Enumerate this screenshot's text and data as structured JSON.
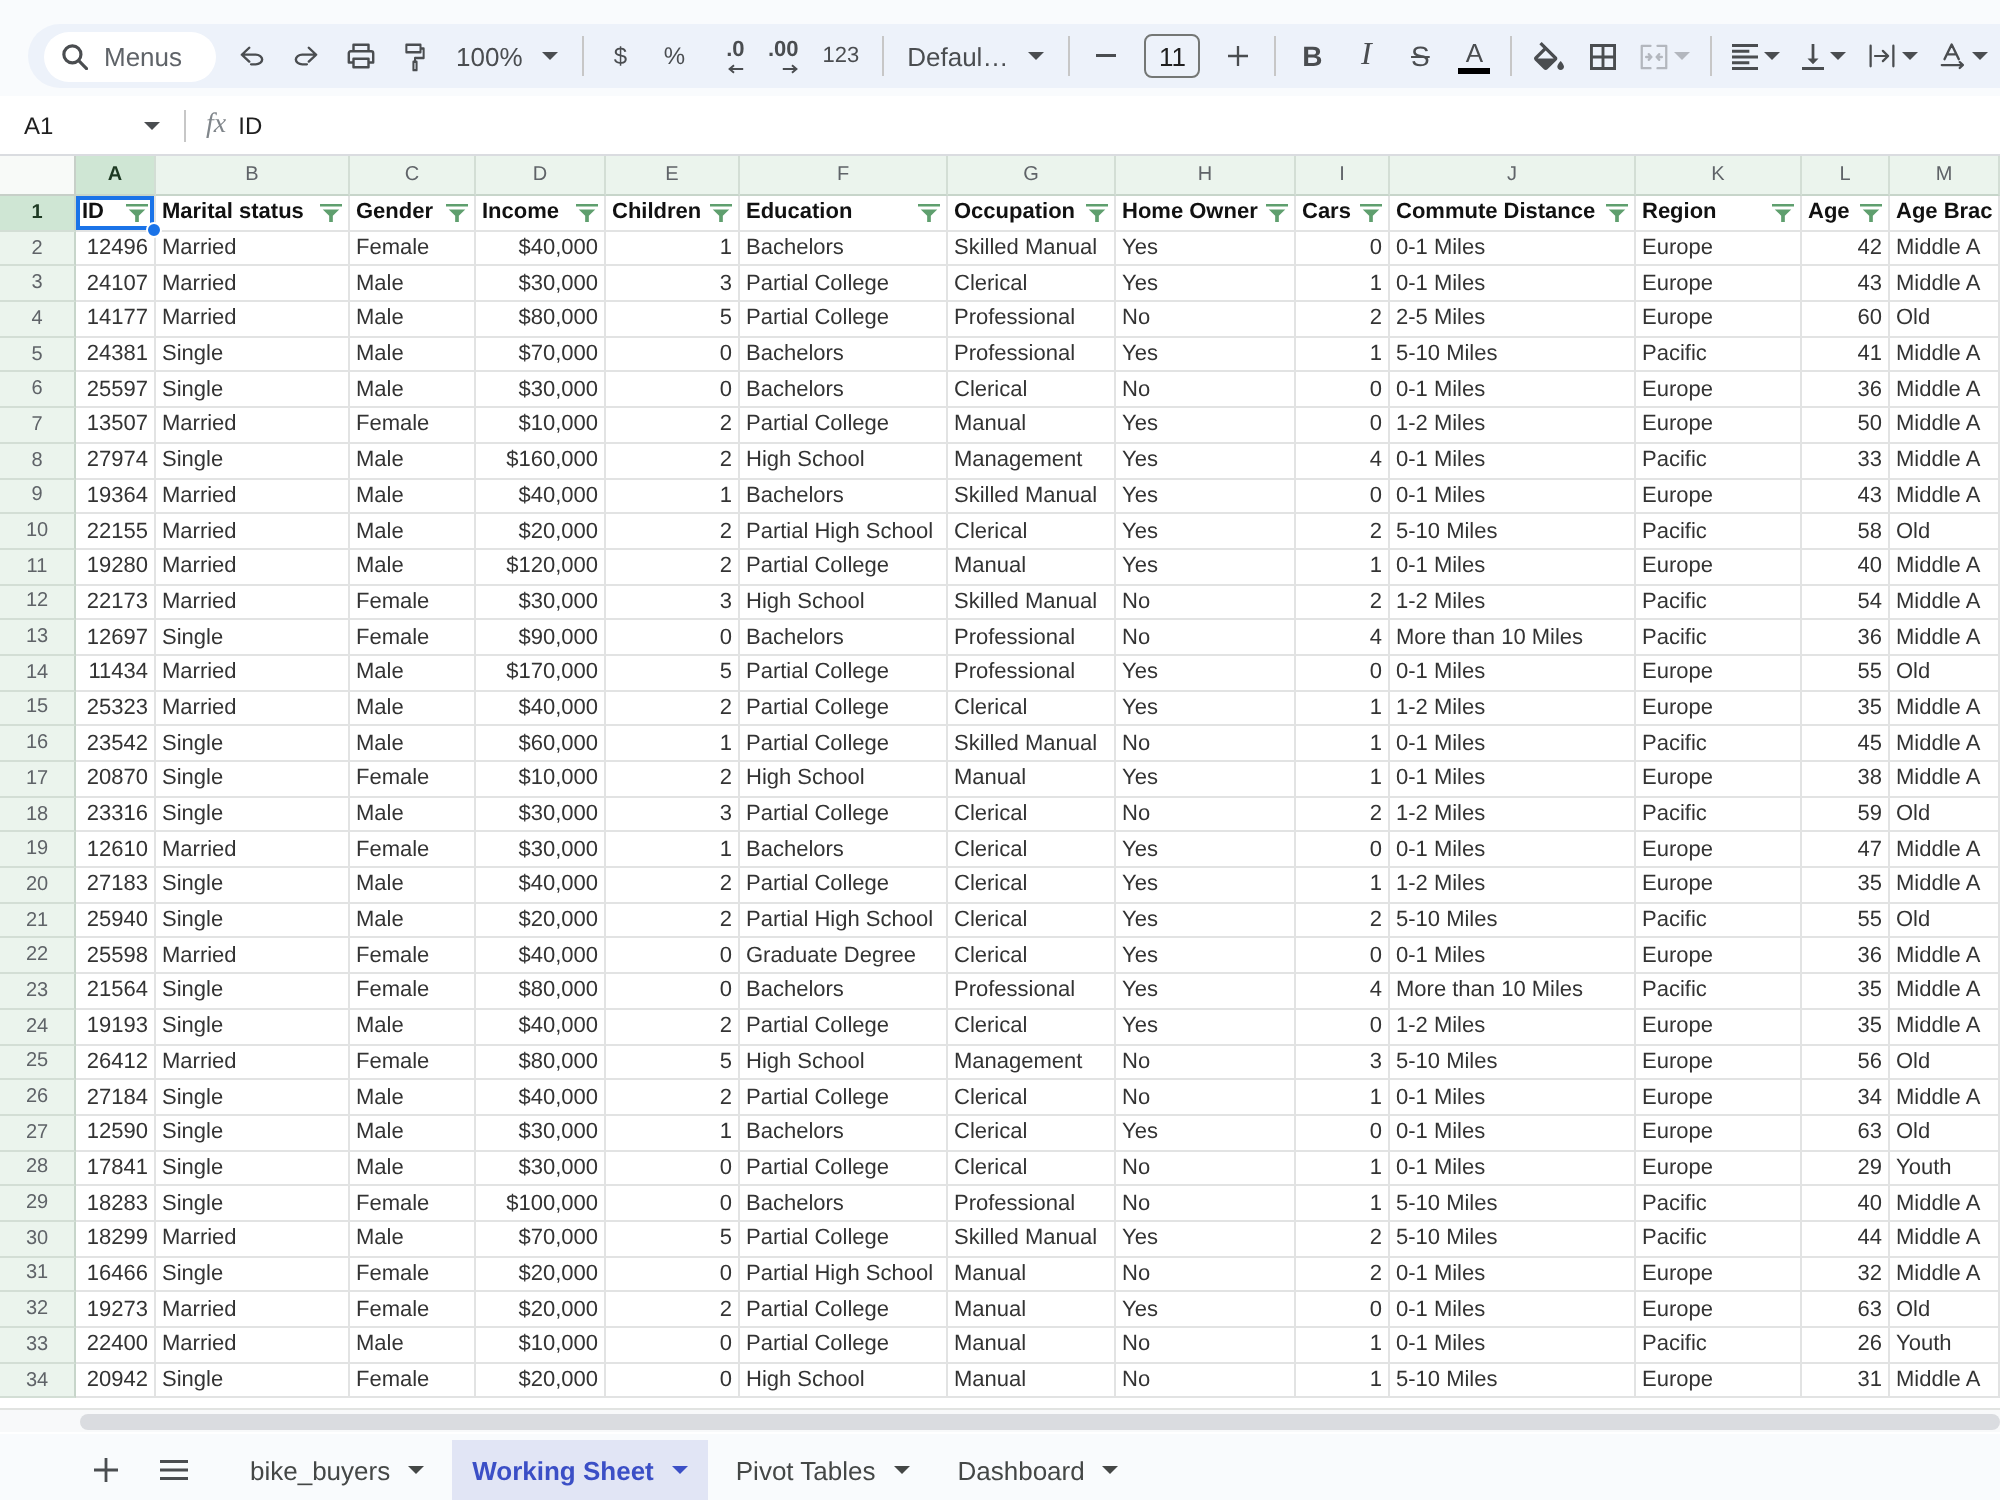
{
  "toolbar": {
    "search": {
      "placeholder": "Menus"
    },
    "groups": [
      [
        {
          "kind": "undo",
          "disabled": false
        },
        {
          "kind": "redo",
          "disabled": false
        },
        {
          "kind": "print",
          "disabled": false
        },
        {
          "kind": "paintformat",
          "disabled": false
        },
        {
          "kind": "zoom",
          "label": "100%",
          "disabled": false
        }
      ],
      [
        {
          "kind": "format",
          "label": "$",
          "disabled": false
        },
        {
          "kind": "format",
          "label": "%",
          "disabled": false
        },
        {
          "kind": "decless",
          "label": ".0",
          "disabled": false
        },
        {
          "kind": "decmore",
          "label": ".00",
          "disabled": false
        },
        {
          "kind": "format",
          "label": "123",
          "disabled": false
        }
      ],
      [
        {
          "kind": "font",
          "label": "Defaul…",
          "disabled": false
        }
      ],
      [
        {
          "kind": "minus",
          "disabled": false
        },
        {
          "kind": "size",
          "value": "11",
          "disabled": false
        },
        {
          "kind": "plus",
          "disabled": false
        }
      ],
      [
        {
          "kind": "bold",
          "label": "B",
          "disabled": false
        },
        {
          "kind": "italic",
          "label": "I",
          "disabled": false
        },
        {
          "kind": "strike",
          "label": "S",
          "disabled": false
        },
        {
          "kind": "textcolor",
          "label": "A",
          "disabled": false
        }
      ],
      [
        {
          "kind": "fill",
          "disabled": false
        },
        {
          "kind": "borders",
          "disabled": false
        },
        {
          "kind": "merge",
          "disabled": true
        }
      ],
      [
        {
          "kind": "halign",
          "disabled": false
        },
        {
          "kind": "valign",
          "disabled": false
        },
        {
          "kind": "wrap",
          "disabled": false
        },
        {
          "kind": "rotate",
          "disabled": false
        }
      ]
    ]
  },
  "formula_bar": {
    "cell_ref": "A1",
    "function_label": "fx",
    "value": "ID"
  },
  "grid": {
    "columns": [
      {
        "letter": "A",
        "kind": "number",
        "selected": true
      },
      {
        "letter": "B",
        "kind": "text",
        "selected": false
      },
      {
        "letter": "C",
        "kind": "text",
        "selected": false
      },
      {
        "letter": "D",
        "kind": "number",
        "selected": false
      },
      {
        "letter": "E",
        "kind": "number",
        "selected": false
      },
      {
        "letter": "F",
        "kind": "text",
        "selected": false
      },
      {
        "letter": "G",
        "kind": "text",
        "selected": false
      },
      {
        "letter": "H",
        "kind": "text",
        "selected": false
      },
      {
        "letter": "I",
        "kind": "number",
        "selected": false
      },
      {
        "letter": "J",
        "kind": "text",
        "selected": false
      },
      {
        "letter": "K",
        "kind": "text",
        "selected": false
      },
      {
        "letter": "L",
        "kind": "number",
        "selected": false
      },
      {
        "letter": "M",
        "kind": "text",
        "selected": false
      }
    ],
    "header_row": {
      "number": "1",
      "selected": true,
      "cells": [
        {
          "text": "ID",
          "filter": true,
          "selected": true
        },
        {
          "text": "Marital status",
          "filter": true,
          "selected": false
        },
        {
          "text": "Gender",
          "filter": true,
          "selected": false
        },
        {
          "text": "Income",
          "filter": true,
          "selected": false
        },
        {
          "text": "Children",
          "filter": true,
          "selected": false
        },
        {
          "text": "Education",
          "filter": true,
          "selected": false
        },
        {
          "text": "Occupation",
          "filter": true,
          "selected": false
        },
        {
          "text": "Home Owner",
          "filter": true,
          "selected": false
        },
        {
          "text": "Cars",
          "filter": true,
          "selected": false
        },
        {
          "text": "Commute Distance",
          "filter": true,
          "selected": false
        },
        {
          "text": "Region",
          "filter": true,
          "selected": false
        },
        {
          "text": "Age",
          "filter": true,
          "selected": false
        },
        {
          "text": "Age Brac",
          "filter": false,
          "selected": false
        }
      ]
    },
    "rows": [
      {
        "number": "2",
        "selected": false,
        "cells": [
          "12496",
          "Married",
          "Female",
          "$40,000",
          "1",
          "Bachelors",
          "Skilled Manual",
          "Yes",
          "0",
          "0-1 Miles",
          "Europe",
          "42",
          "Middle A"
        ]
      },
      {
        "number": "3",
        "selected": false,
        "cells": [
          "24107",
          "Married",
          "Male",
          "$30,000",
          "3",
          "Partial College",
          "Clerical",
          "Yes",
          "1",
          "0-1 Miles",
          "Europe",
          "43",
          "Middle A"
        ]
      },
      {
        "number": "4",
        "selected": false,
        "cells": [
          "14177",
          "Married",
          "Male",
          "$80,000",
          "5",
          "Partial College",
          "Professional",
          "No",
          "2",
          "2-5 Miles",
          "Europe",
          "60",
          "Old"
        ]
      },
      {
        "number": "5",
        "selected": false,
        "cells": [
          "24381",
          "Single",
          "Male",
          "$70,000",
          "0",
          "Bachelors",
          "Professional",
          "Yes",
          "1",
          "5-10 Miles",
          "Pacific",
          "41",
          "Middle A"
        ]
      },
      {
        "number": "6",
        "selected": false,
        "cells": [
          "25597",
          "Single",
          "Male",
          "$30,000",
          "0",
          "Bachelors",
          "Clerical",
          "No",
          "0",
          "0-1 Miles",
          "Europe",
          "36",
          "Middle A"
        ]
      },
      {
        "number": "7",
        "selected": false,
        "cells": [
          "13507",
          "Married",
          "Female",
          "$10,000",
          "2",
          "Partial College",
          "Manual",
          "Yes",
          "0",
          "1-2 Miles",
          "Europe",
          "50",
          "Middle A"
        ]
      },
      {
        "number": "8",
        "selected": false,
        "cells": [
          "27974",
          "Single",
          "Male",
          "$160,000",
          "2",
          "High School",
          "Management",
          "Yes",
          "4",
          "0-1 Miles",
          "Pacific",
          "33",
          "Middle A"
        ]
      },
      {
        "number": "9",
        "selected": false,
        "cells": [
          "19364",
          "Married",
          "Male",
          "$40,000",
          "1",
          "Bachelors",
          "Skilled Manual",
          "Yes",
          "0",
          "0-1 Miles",
          "Europe",
          "43",
          "Middle A"
        ]
      },
      {
        "number": "10",
        "selected": false,
        "cells": [
          "22155",
          "Married",
          "Male",
          "$20,000",
          "2",
          "Partial High School",
          "Clerical",
          "Yes",
          "2",
          "5-10 Miles",
          "Pacific",
          "58",
          "Old"
        ]
      },
      {
        "number": "11",
        "selected": false,
        "cells": [
          "19280",
          "Married",
          "Male",
          "$120,000",
          "2",
          "Partial College",
          "Manual",
          "Yes",
          "1",
          "0-1 Miles",
          "Europe",
          "40",
          "Middle A"
        ]
      },
      {
        "number": "12",
        "selected": false,
        "cells": [
          "22173",
          "Married",
          "Female",
          "$30,000",
          "3",
          "High School",
          "Skilled Manual",
          "No",
          "2",
          "1-2 Miles",
          "Pacific",
          "54",
          "Middle A"
        ]
      },
      {
        "number": "13",
        "selected": false,
        "cells": [
          "12697",
          "Single",
          "Female",
          "$90,000",
          "0",
          "Bachelors",
          "Professional",
          "No",
          "4",
          "More than 10 Miles",
          "Pacific",
          "36",
          "Middle A"
        ]
      },
      {
        "number": "14",
        "selected": false,
        "cells": [
          "11434",
          "Married",
          "Male",
          "$170,000",
          "5",
          "Partial College",
          "Professional",
          "Yes",
          "0",
          "0-1 Miles",
          "Europe",
          "55",
          "Old"
        ]
      },
      {
        "number": "15",
        "selected": false,
        "cells": [
          "25323",
          "Married",
          "Male",
          "$40,000",
          "2",
          "Partial College",
          "Clerical",
          "Yes",
          "1",
          "1-2 Miles",
          "Europe",
          "35",
          "Middle A"
        ]
      },
      {
        "number": "16",
        "selected": false,
        "cells": [
          "23542",
          "Single",
          "Male",
          "$60,000",
          "1",
          "Partial College",
          "Skilled Manual",
          "No",
          "1",
          "0-1 Miles",
          "Pacific",
          "45",
          "Middle A"
        ]
      },
      {
        "number": "17",
        "selected": false,
        "cells": [
          "20870",
          "Single",
          "Female",
          "$10,000",
          "2",
          "High School",
          "Manual",
          "Yes",
          "1",
          "0-1 Miles",
          "Europe",
          "38",
          "Middle A"
        ]
      },
      {
        "number": "18",
        "selected": false,
        "cells": [
          "23316",
          "Single",
          "Male",
          "$30,000",
          "3",
          "Partial College",
          "Clerical",
          "No",
          "2",
          "1-2 Miles",
          "Pacific",
          "59",
          "Old"
        ]
      },
      {
        "number": "19",
        "selected": false,
        "cells": [
          "12610",
          "Married",
          "Female",
          "$30,000",
          "1",
          "Bachelors",
          "Clerical",
          "Yes",
          "0",
          "0-1 Miles",
          "Europe",
          "47",
          "Middle A"
        ]
      },
      {
        "number": "20",
        "selected": false,
        "cells": [
          "27183",
          "Single",
          "Male",
          "$40,000",
          "2",
          "Partial College",
          "Clerical",
          "Yes",
          "1",
          "1-2 Miles",
          "Europe",
          "35",
          "Middle A"
        ]
      },
      {
        "number": "21",
        "selected": false,
        "cells": [
          "25940",
          "Single",
          "Male",
          "$20,000",
          "2",
          "Partial High School",
          "Clerical",
          "Yes",
          "2",
          "5-10 Miles",
          "Pacific",
          "55",
          "Old"
        ]
      },
      {
        "number": "22",
        "selected": false,
        "cells": [
          "25598",
          "Married",
          "Female",
          "$40,000",
          "0",
          "Graduate Degree",
          "Clerical",
          "Yes",
          "0",
          "0-1 Miles",
          "Europe",
          "36",
          "Middle A"
        ]
      },
      {
        "number": "23",
        "selected": false,
        "cells": [
          "21564",
          "Single",
          "Female",
          "$80,000",
          "0",
          "Bachelors",
          "Professional",
          "Yes",
          "4",
          "More than 10 Miles",
          "Pacific",
          "35",
          "Middle A"
        ]
      },
      {
        "number": "24",
        "selected": false,
        "cells": [
          "19193",
          "Single",
          "Male",
          "$40,000",
          "2",
          "Partial College",
          "Clerical",
          "Yes",
          "0",
          "1-2 Miles",
          "Europe",
          "35",
          "Middle A"
        ]
      },
      {
        "number": "25",
        "selected": false,
        "cells": [
          "26412",
          "Married",
          "Female",
          "$80,000",
          "5",
          "High School",
          "Management",
          "No",
          "3",
          "5-10 Miles",
          "Europe",
          "56",
          "Old"
        ]
      },
      {
        "number": "26",
        "selected": false,
        "cells": [
          "27184",
          "Single",
          "Male",
          "$40,000",
          "2",
          "Partial College",
          "Clerical",
          "No",
          "1",
          "0-1 Miles",
          "Europe",
          "34",
          "Middle A"
        ]
      },
      {
        "number": "27",
        "selected": false,
        "cells": [
          "12590",
          "Single",
          "Male",
          "$30,000",
          "1",
          "Bachelors",
          "Clerical",
          "Yes",
          "0",
          "0-1 Miles",
          "Europe",
          "63",
          "Old"
        ]
      },
      {
        "number": "28",
        "selected": false,
        "cells": [
          "17841",
          "Single",
          "Male",
          "$30,000",
          "0",
          "Partial College",
          "Clerical",
          "No",
          "1",
          "0-1 Miles",
          "Europe",
          "29",
          "Youth"
        ]
      },
      {
        "number": "29",
        "selected": false,
        "cells": [
          "18283",
          "Single",
          "Female",
          "$100,000",
          "0",
          "Bachelors",
          "Professional",
          "No",
          "1",
          "5-10 Miles",
          "Pacific",
          "40",
          "Middle A"
        ]
      },
      {
        "number": "30",
        "selected": false,
        "cells": [
          "18299",
          "Married",
          "Male",
          "$70,000",
          "5",
          "Partial College",
          "Skilled Manual",
          "Yes",
          "2",
          "5-10 Miles",
          "Pacific",
          "44",
          "Middle A"
        ]
      },
      {
        "number": "31",
        "selected": false,
        "cells": [
          "16466",
          "Single",
          "Female",
          "$20,000",
          "0",
          "Partial High School",
          "Manual",
          "No",
          "2",
          "0-1 Miles",
          "Europe",
          "32",
          "Middle A"
        ]
      },
      {
        "number": "32",
        "selected": false,
        "cells": [
          "19273",
          "Married",
          "Female",
          "$20,000",
          "2",
          "Partial College",
          "Manual",
          "Yes",
          "0",
          "0-1 Miles",
          "Europe",
          "63",
          "Old"
        ]
      },
      {
        "number": "33",
        "selected": false,
        "cells": [
          "22400",
          "Married",
          "Male",
          "$10,000",
          "0",
          "Partial College",
          "Manual",
          "No",
          "1",
          "0-1 Miles",
          "Pacific",
          "26",
          "Youth"
        ]
      },
      {
        "number": "34",
        "selected": false,
        "cells": [
          "20942",
          "Single",
          "Female",
          "$20,000",
          "0",
          "High School",
          "Manual",
          "No",
          "1",
          "5-10 Miles",
          "Europe",
          "31",
          "Middle A"
        ]
      }
    ]
  },
  "sheet_tabs": [
    {
      "label": "bike_buyers",
      "selected": false
    },
    {
      "label": "Working Sheet",
      "selected": true
    },
    {
      "label": "Pivot Tables",
      "selected": false
    },
    {
      "label": "Dashboard",
      "selected": false
    }
  ]
}
